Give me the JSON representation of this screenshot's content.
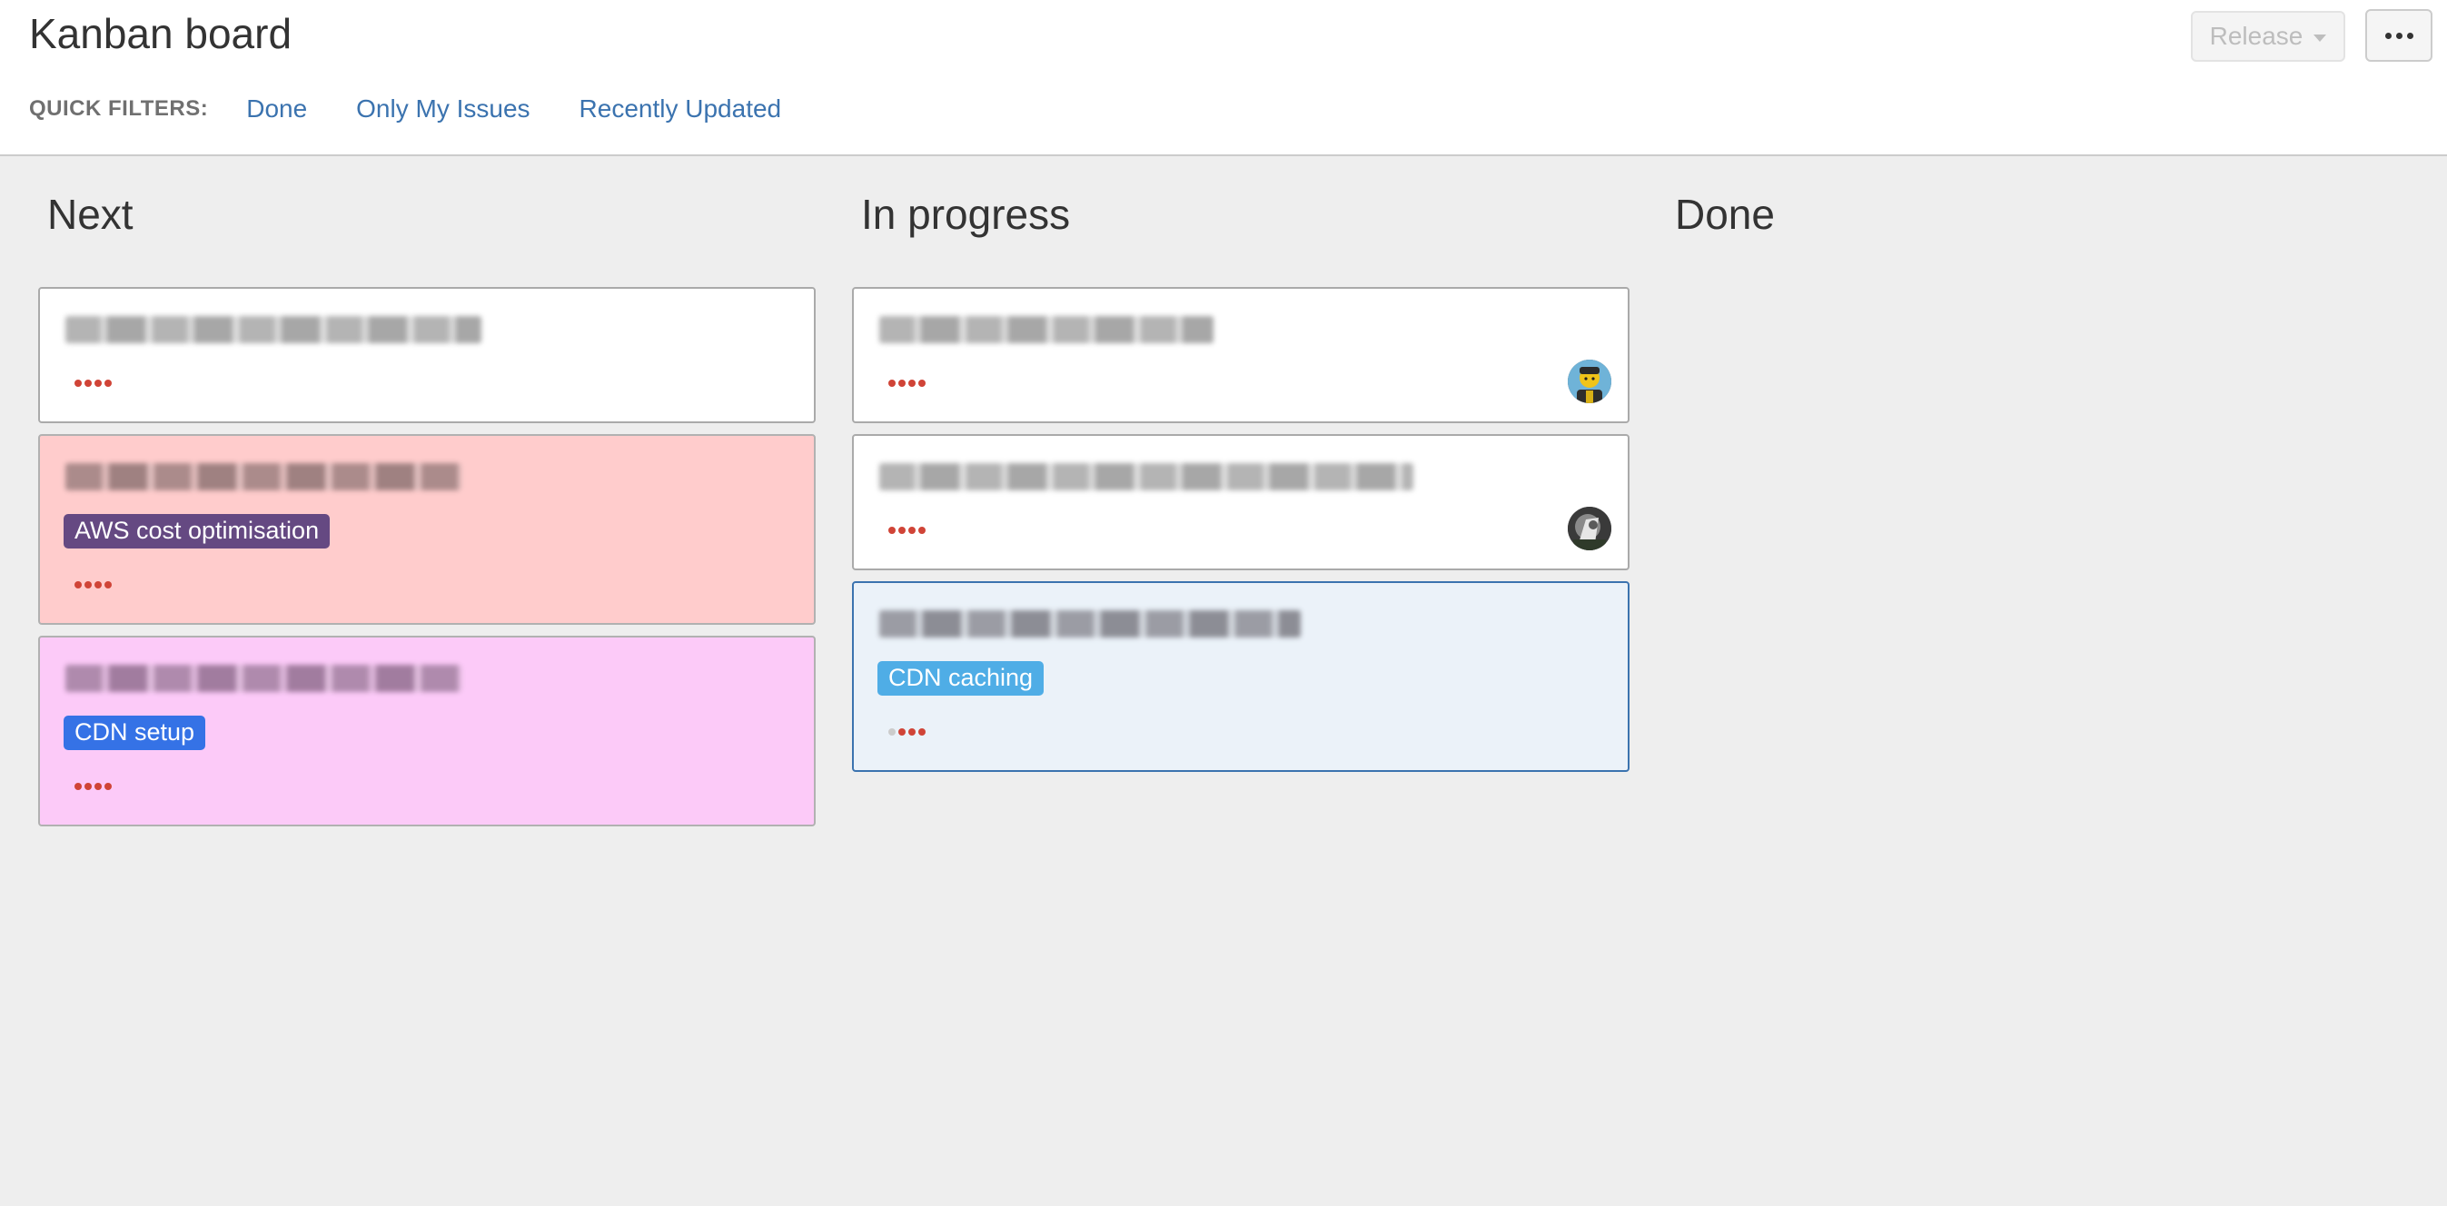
{
  "header": {
    "title": "Kanban board",
    "quick_filters_label": "QUICK FILTERS:",
    "quick_filters": [
      "Done",
      "Only My Issues",
      "Recently Updated"
    ],
    "release_label": "Release",
    "more_icon": "more-dots-icon"
  },
  "columns": [
    {
      "title": "Next",
      "cards": [
        {
          "summary": "",
          "summary_blurred": true,
          "color": "white",
          "epic": null,
          "priority_dots": 4,
          "assignee": null
        },
        {
          "summary": "",
          "summary_blurred": true,
          "color": "#ffcccc",
          "epic": {
            "label": "AWS cost optimisation",
            "color": "#654982"
          },
          "priority_dots": 4,
          "assignee": null
        },
        {
          "summary": "",
          "summary_blurred": true,
          "color": "#fccaf8",
          "epic": {
            "label": "CDN setup",
            "color": "#3572e6"
          },
          "priority_dots": 4,
          "assignee": null
        }
      ]
    },
    {
      "title": "In progress",
      "cards": [
        {
          "summary": "",
          "summary_blurred": true,
          "color": "white",
          "epic": null,
          "priority_dots": 4,
          "assignee": "avatar-1"
        },
        {
          "summary": "",
          "summary_blurred": true,
          "color": "white",
          "epic": null,
          "priority_dots": 4,
          "assignee": "avatar-2"
        },
        {
          "summary": "",
          "summary_blurred": true,
          "color": "#ebf2f9",
          "selected": true,
          "epic": {
            "label": "CDN caching",
            "color": "#4fade6"
          },
          "priority_dots": 3,
          "assignee": null
        }
      ]
    },
    {
      "title": "Done",
      "cards": []
    }
  ],
  "colors": {
    "link": "#3b73af",
    "priority": "#d04437",
    "selected_border": "#3b73af",
    "board_background": "#eeeeee"
  }
}
